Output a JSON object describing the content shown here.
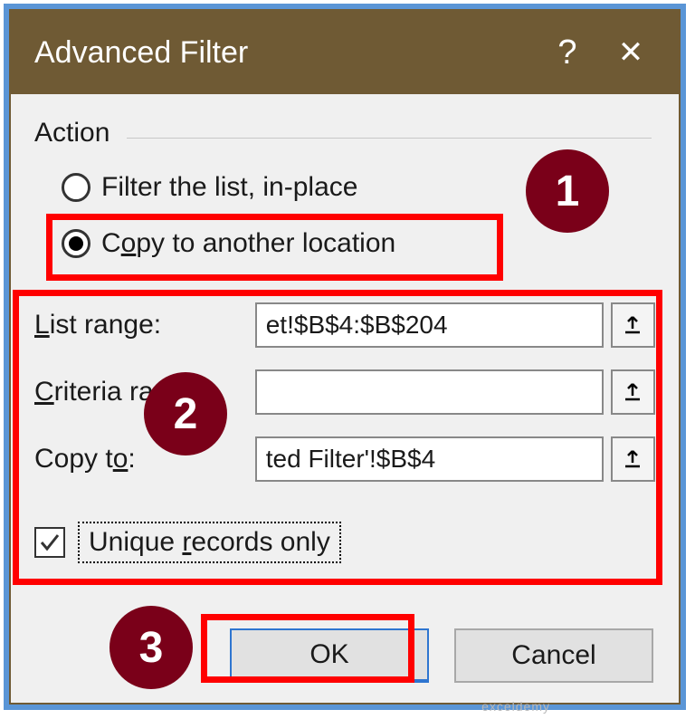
{
  "title": "Advanced Filter",
  "action_group": "Action",
  "radios": {
    "inplace": "Filter the list, in-place",
    "copyto_pre": "C",
    "copyto_u": "o",
    "copyto_post": "py to another location"
  },
  "fields": {
    "list_label_pre": "L",
    "list_label_post": "ist range:",
    "list_value": "et!$B$4:$B$204",
    "criteria_label_pre": "C",
    "criteria_label_post": "riteria range:",
    "criteria_value": "",
    "copyto_label_pre": "Copy t",
    "copyto_label_u": "o",
    "copyto_label_post": ":",
    "copyto_value": "ted Filter'!$B$4"
  },
  "checkbox": {
    "pre": "Unique ",
    "u": "r",
    "post": "ecords only"
  },
  "buttons": {
    "ok": "OK",
    "cancel": "Cancel"
  },
  "badges": {
    "one": "1",
    "two": "2",
    "three": "3"
  },
  "watermark": "exceldemy"
}
